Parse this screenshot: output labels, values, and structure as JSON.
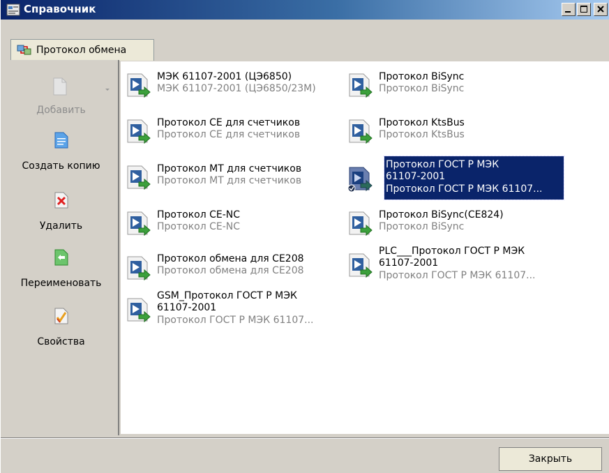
{
  "window": {
    "title": "Справочник",
    "tab_label": "Протокол обмена"
  },
  "sidebar": {
    "add": "Добавить",
    "copy": "Создать копию",
    "delete": "Удалить",
    "rename": "Переименовать",
    "properties": "Свойства"
  },
  "items": [
    {
      "title": "МЭК 61107-2001 (ЦЭ6850)",
      "subtitle": "МЭК 61107-2001 (ЦЭ6850/23М)",
      "selected": false
    },
    {
      "title": "Протокол BiSync",
      "subtitle": "Протокол BiSync",
      "selected": false
    },
    {
      "title": "Протокол CE для счетчиков",
      "subtitle": "Протокол CE для счетчиков",
      "selected": false
    },
    {
      "title": "Протокол KtsBus",
      "subtitle": "Протокол KtsBus",
      "selected": false
    },
    {
      "title": "Протокол MT для счетчиков",
      "subtitle": "Протокол MT для счетчиков",
      "selected": false
    },
    {
      "title": "Протокол ГОСТ Р МЭК 61107-2001",
      "title_line1": "Протокол ГОСТ Р МЭК",
      "title_line2": "61107-2001",
      "subtitle": "Протокол ГОСТ Р МЭК 61107...",
      "selected": true
    },
    {
      "title": "Протокол CE-NC",
      "subtitle": "Протокол CE-NC",
      "selected": false
    },
    {
      "title": "Протокол BiSync(CE824)",
      "subtitle": "Протокол BiSync",
      "selected": false
    },
    {
      "title": "Протокол обмена для CE208",
      "subtitle": "Протокол обмена для CE208",
      "selected": false
    },
    {
      "title": "PLC___Протокол ГОСТ Р МЭК 61107-2001",
      "title_line1": "PLC___Протокол ГОСТ Р МЭК",
      "title_line2": "61107-2001",
      "subtitle": "Протокол ГОСТ Р МЭК 61107...",
      "selected": false
    },
    {
      "title": "GSM_Протокол ГОСТ Р МЭК 61107-2001",
      "title_line1": "GSM_Протокол ГОСТ Р МЭК",
      "title_line2": "61107-2001",
      "subtitle": "Протокол ГОСТ Р МЭК 61107...",
      "selected": false
    }
  ],
  "footer": {
    "close_label": "Закрыть"
  },
  "colors": {
    "title_bar": "#0a246a",
    "selection": "#0a246a",
    "dialog_bg": "#d4d0c8",
    "secondary_text": "#808080"
  }
}
